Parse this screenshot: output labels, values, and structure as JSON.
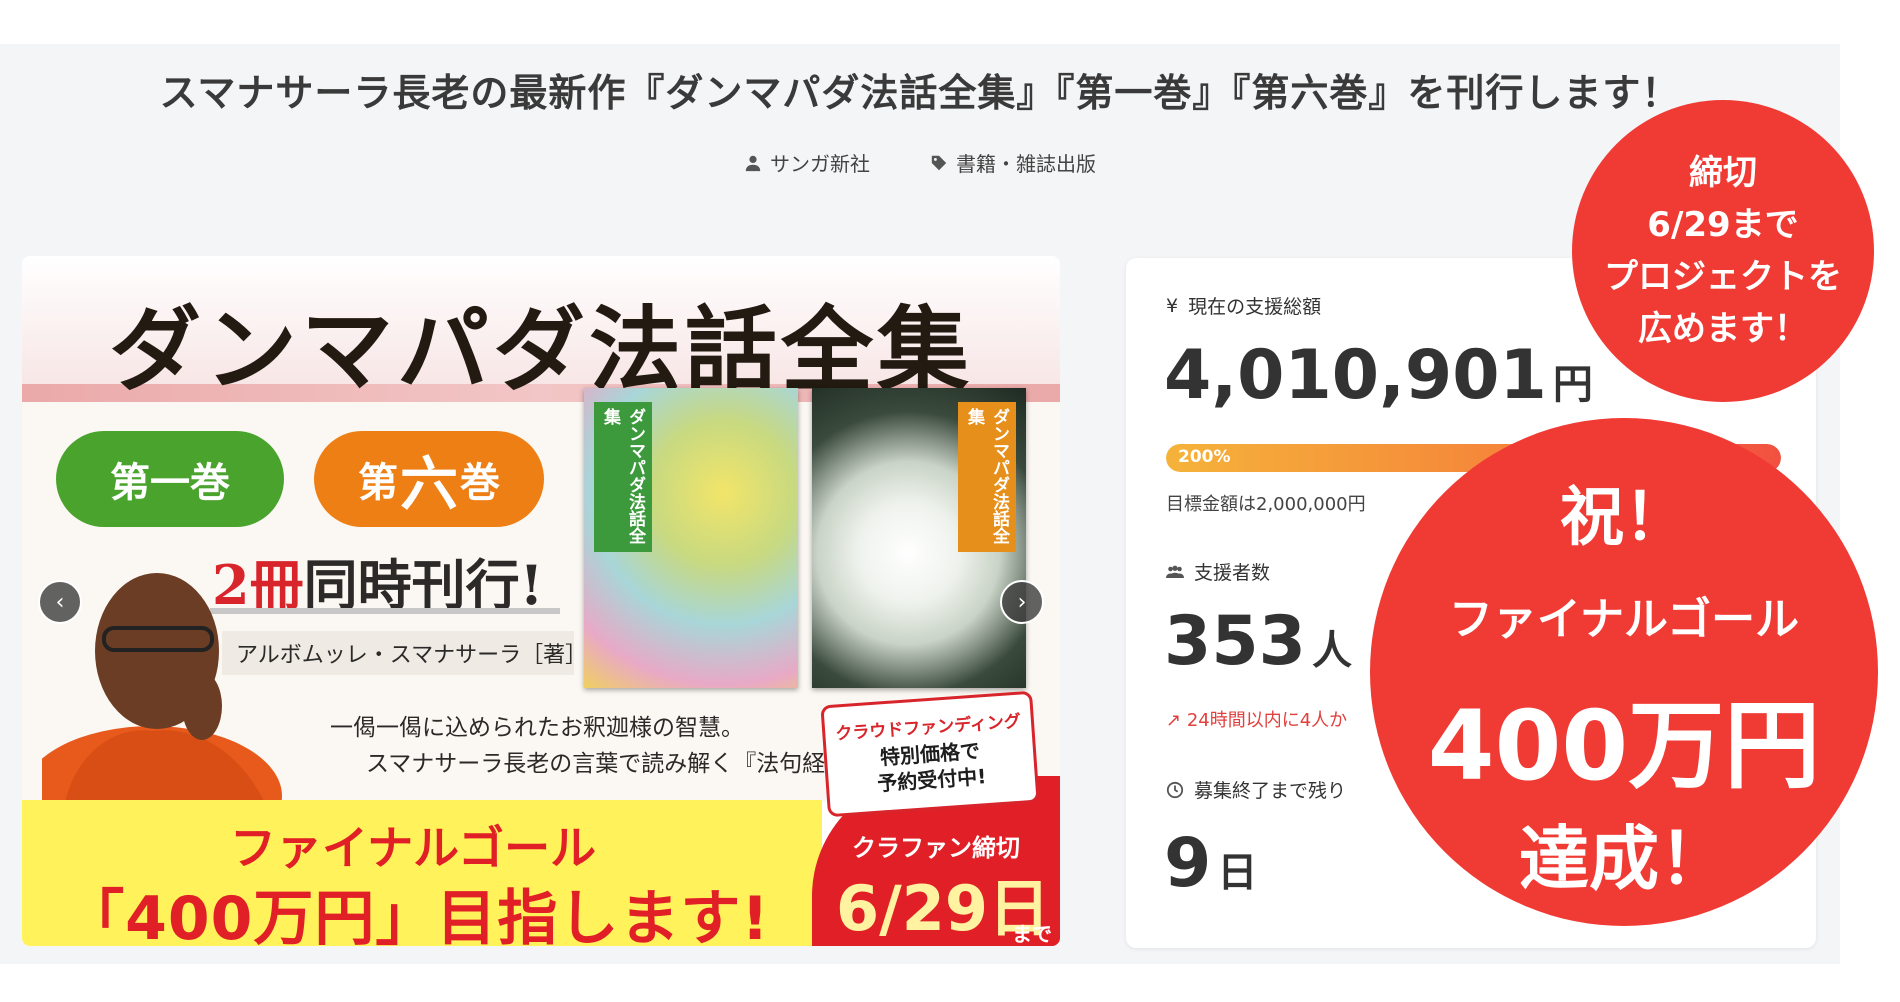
{
  "project": {
    "title": "スマナサーラ長老の最新作『ダンマパダ法話全集』『第一巻』『第六巻』を刊行します！",
    "owner": "サンガ新社",
    "category": "書籍・雑誌出版",
    "owner_icon": "person-icon",
    "category_icon": "tag-icon"
  },
  "banner": {
    "heading": "ダンマパダ法話全集",
    "vol1": "第一巻",
    "vol6_prefix": "第",
    "vol6_big": "六",
    "vol6_suffix": "巻",
    "simul_red": "2冊",
    "simul_rest": "同時刊行!",
    "author": "アルボムッレ・スマナサーラ［著］",
    "tagline1": "一偈一偈に込められたお釈迦様の智慧。",
    "tagline2": "スマナサーラ長老の言葉で読み解く『法句経』。",
    "book_title": "ダンマパダ法話全集",
    "crowd_line1": "クラウドファンディング",
    "crowd_line2": "特別価格で",
    "crowd_line3": "予約受付中!",
    "final_line1": "ファイナルゴール",
    "final_line2": "「400万円」目指します!",
    "deadline_label": "クラファン締切",
    "deadline_date": "6/29日",
    "deadline_suffix": "まで"
  },
  "stats": {
    "total_label": "現在の支援総額",
    "total_value": "4,010,901",
    "total_unit": "円",
    "progress_label": "200%",
    "progress_fraction": 1.0,
    "goal_text": "目標金額は2,000,000円",
    "supporters_label": "支援者数",
    "supporters_value": "353",
    "supporters_unit": "人",
    "trend_text": "24時間以内に4人か",
    "remaining_label": "募集終了まで残り",
    "remaining_value": "9",
    "remaining_unit": "日"
  },
  "overlay": {
    "small": [
      "締切",
      "6/29まで",
      "プロジェクトを",
      "広めます！"
    ],
    "big_line1": "祝！",
    "big_line2": "ファイナルゴール",
    "big_line3": "400万円",
    "big_line4": "達成！"
  },
  "colors": {
    "accent_red": "#f03a34",
    "progress_start": "#f5b33a",
    "progress_end": "#f25040",
    "green_pill": "#4aa32d",
    "orange_pill": "#ee7f15",
    "yellow_band": "#fff25a"
  }
}
